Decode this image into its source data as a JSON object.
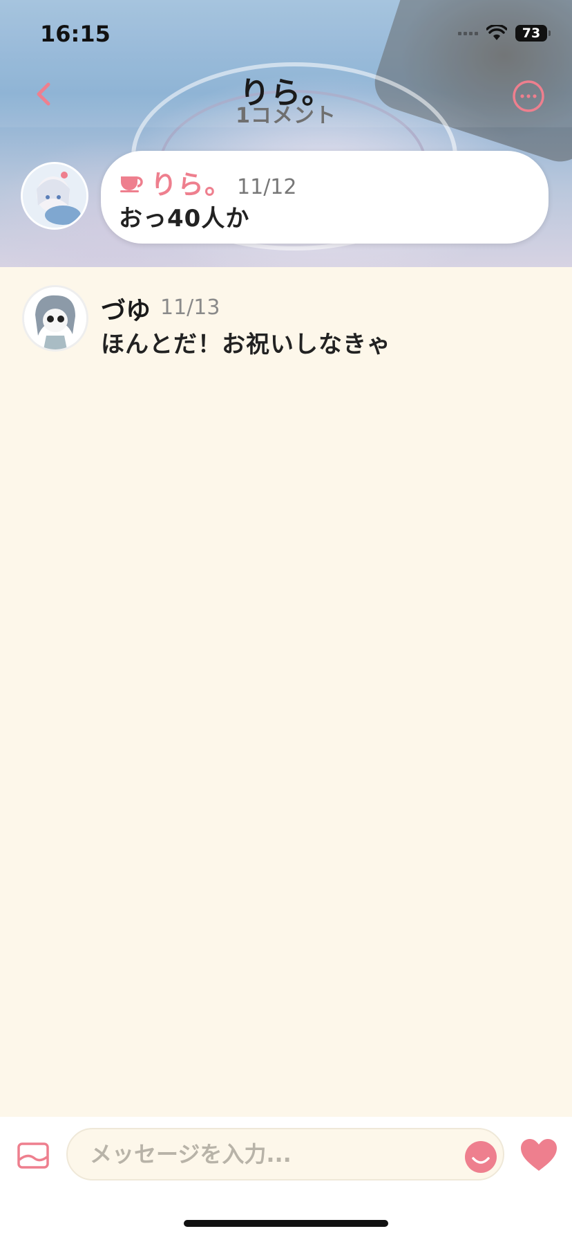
{
  "status_bar": {
    "time": "16:15",
    "battery": "73"
  },
  "nav": {
    "title": "りら。",
    "subtitle": "1コメント"
  },
  "post": {
    "author": "りら。",
    "date": "11/12",
    "text": "おっ40人か"
  },
  "replies": [
    {
      "author": "づゆ",
      "date": "11/13",
      "text": "ほんとだ！お祝いしなきゃ"
    }
  ],
  "composer": {
    "placeholder": "メッセージを入力..."
  },
  "colors": {
    "accent": "#ee7f8e",
    "background": "#fdf7ea"
  },
  "icons": {
    "back": "chevron-left-icon",
    "more": "more-horizontal-icon",
    "author_badge": "cup-icon",
    "image": "image-icon",
    "emoji": "smile-icon",
    "like": "heart-icon"
  }
}
